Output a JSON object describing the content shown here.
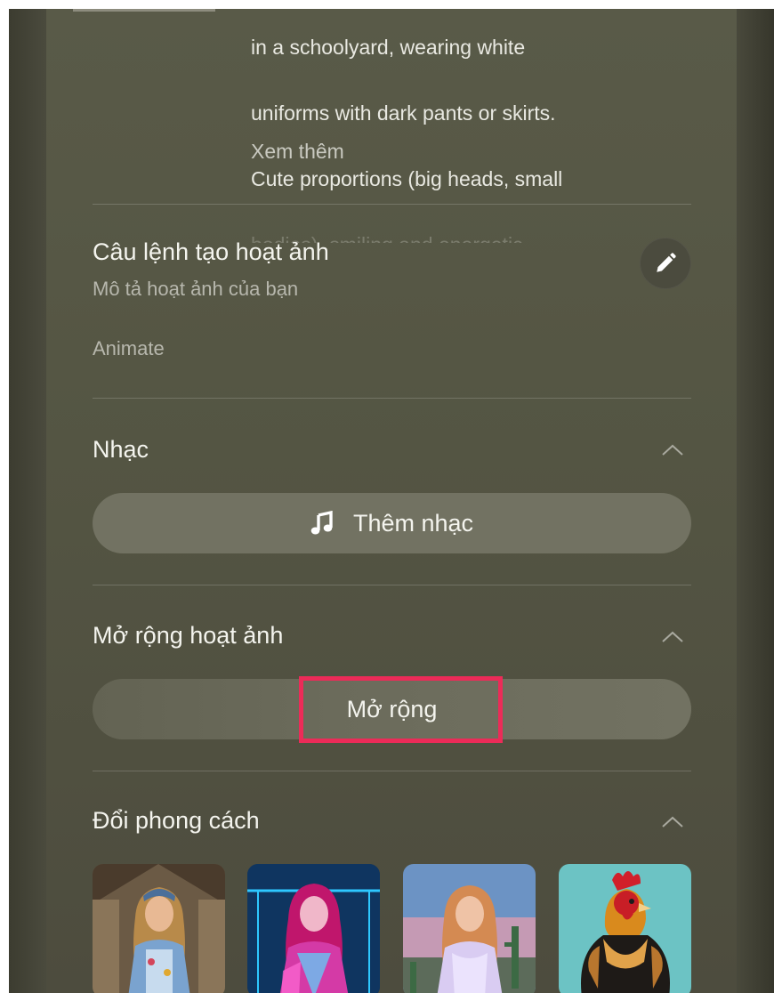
{
  "description_prompt": {
    "lines": [
      "in a schoolyard, wearing white",
      "uniforms with dark pants or skirts.",
      "Cute proportions (big heads, small",
      "bodies), smiling and energetic"
    ],
    "see_more_label": "Xem thêm"
  },
  "animation_prompt": {
    "title": "Câu lệnh tạo hoạt ảnh",
    "subtitle": "Mô tả hoạt ảnh của bạn",
    "value": "Animate",
    "edit_icon": "pencil-icon"
  },
  "music": {
    "title": "Nhạc",
    "button_label": "Thêm nhạc",
    "button_icon": "music-note-icon",
    "toggle_icon": "chevron-up-icon"
  },
  "extend": {
    "title": "Mở rộng hoạt ảnh",
    "button_label": "Mở rộng",
    "toggle_icon": "chevron-up-icon",
    "highlight_color": "#ec2b58"
  },
  "style": {
    "title": "Đổi phong cách",
    "toggle_icon": "chevron-up-icon",
    "thumbnails": [
      "denim-barn-style-thumbnail",
      "neon-cyber-style-thumbnail",
      "desert-dusk-style-thumbnail",
      "rooster-style-thumbnail"
    ]
  },
  "colors": {
    "panel_bg": "#575845",
    "button_bg": "#727262",
    "text_primary": "#f4f4ee",
    "text_secondary": "#b7b7ad",
    "highlight": "#ec2b58"
  }
}
